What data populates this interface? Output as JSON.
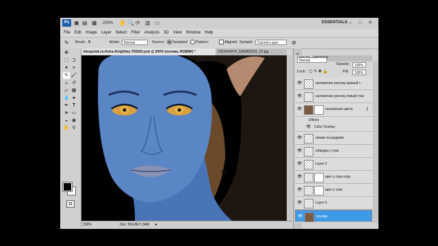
{
  "app": {
    "title_zoom": "200%",
    "workspace": "ESSENTIALS"
  },
  "menu": [
    "File",
    "Edit",
    "Image",
    "Layer",
    "Select",
    "Filter",
    "Analysis",
    "3D",
    "View",
    "Window",
    "Help"
  ],
  "options": {
    "brush_label": "Brush:",
    "brush_size": "9",
    "mode_label": "Mode:",
    "mode_value": "Normal",
    "source_label": "Source:",
    "sampled": "Sampled",
    "pattern": "Pattern:",
    "aligned": "Aligned",
    "sample_label": "Sample:",
    "sample_value": "Current Layer"
  },
  "tabs": [
    {
      "label": "kinopoisk.ru-Keira-Knightley-755263.psd @ 200% (основа, RGB/8#) *"
    },
    {
      "label": "1262414974_1260801911_22.jpg"
    }
  ],
  "status": {
    "zoom": "200%",
    "doc": "Doc: 554.8K/7.34M"
  },
  "panel": {
    "tabs": [
      "LAYERS",
      "HISTORY"
    ],
    "blend": "Normal",
    "opacity_label": "Opacity:",
    "opacity": "100%",
    "lock_label": "Lock:",
    "fill_label": "Fill:",
    "fill": "100%"
  },
  "layers": [
    {
      "name": "наложение ресниц правый г..."
    },
    {
      "name": "наложение ресниц левый глаз"
    },
    {
      "name": "наложение цвета"
    },
    {
      "name": "Effects"
    },
    {
      "name": "Color Overlay"
    },
    {
      "name": "линии на радужке"
    },
    {
      "name": "обводка у глаз"
    },
    {
      "name": "Layer 2"
    },
    {
      "name": "цвет у глаз copy"
    },
    {
      "name": "цвет у глаз"
    },
    {
      "name": "Layer 5"
    },
    {
      "name": "основа"
    }
  ],
  "colors": {
    "skin": "#5a86c6",
    "select": "#3e9ae6"
  }
}
